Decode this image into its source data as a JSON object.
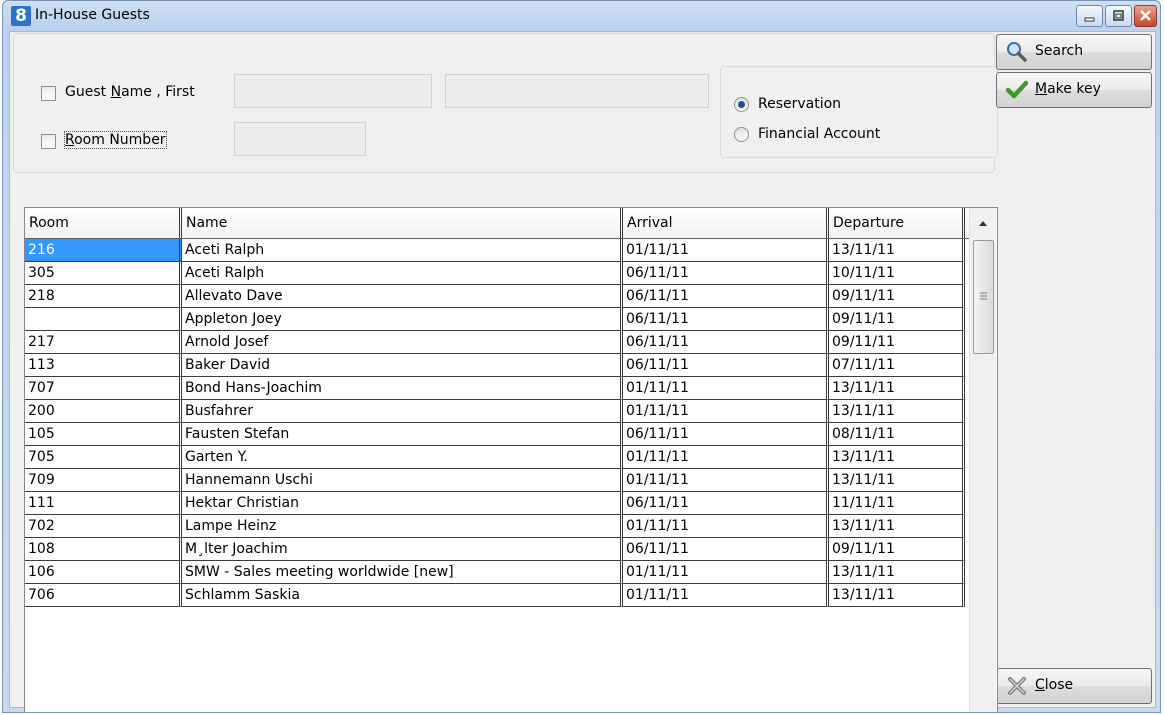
{
  "window": {
    "title": "In-House Guests",
    "app_icon_glyph": "8"
  },
  "filters": {
    "guest_name_label_pre": "Guest ",
    "guest_name_label_key": "N",
    "guest_name_label_post": "ame , First",
    "guest_name_checked": false,
    "guest_name_value": "",
    "guest_first_value": "",
    "room_number_label_key": "R",
    "room_number_label_post": "oom Number",
    "room_number_checked": false,
    "room_number_value": ""
  },
  "mode": {
    "reservation_label": "Reservation",
    "financial_label": "Financial Account",
    "selected": "Reservation"
  },
  "buttons": {
    "search": "Search",
    "make_key_key": "M",
    "make_key_rest": "ake key",
    "close_key": "C",
    "close_rest": "lose"
  },
  "table": {
    "columns": [
      "Room",
      "Name",
      "Arrival",
      "Departure"
    ],
    "rows": [
      {
        "room": "216",
        "name": "Aceti  Ralph",
        "arrival": "01/11/11",
        "departure": "13/11/11"
      },
      {
        "room": "305",
        "name": "Aceti  Ralph",
        "arrival": "06/11/11",
        "departure": "10/11/11"
      },
      {
        "room": "218",
        "name": "Allevato  Dave",
        "arrival": "06/11/11",
        "departure": "09/11/11"
      },
      {
        "room": "",
        "name": "Appleton  Joey",
        "arrival": "06/11/11",
        "departure": "09/11/11"
      },
      {
        "room": "217",
        "name": "Arnold  Josef",
        "arrival": "06/11/11",
        "departure": "09/11/11"
      },
      {
        "room": "113",
        "name": "Baker  David",
        "arrival": "06/11/11",
        "departure": "07/11/11"
      },
      {
        "room": "707",
        "name": "Bond  Hans-Joachim",
        "arrival": "01/11/11",
        "departure": "13/11/11"
      },
      {
        "room": "200",
        "name": "Busfahrer",
        "arrival": "01/11/11",
        "departure": "13/11/11"
      },
      {
        "room": "105",
        "name": "Fausten  Stefan",
        "arrival": "06/11/11",
        "departure": "08/11/11"
      },
      {
        "room": "705",
        "name": "Garten  Y.",
        "arrival": "01/11/11",
        "departure": "13/11/11"
      },
      {
        "room": "709",
        "name": "Hannemann  Uschi",
        "arrival": "01/11/11",
        "departure": "13/11/11"
      },
      {
        "room": "111",
        "name": "Hektar  Christian",
        "arrival": "06/11/11",
        "departure": "11/11/11"
      },
      {
        "room": "702",
        "name": "Lampe  Heinz",
        "arrival": "01/11/11",
        "departure": "13/11/11"
      },
      {
        "room": "108",
        "name": "M¸lter  Joachim",
        "arrival": "06/11/11",
        "departure": "09/11/11"
      },
      {
        "room": "106",
        "name": "SMW - Sales meeting worldwide [new]",
        "arrival": "01/11/11",
        "departure": "13/11/11"
      },
      {
        "room": "706",
        "name": "Schlamm  Saskia",
        "arrival": "01/11/11",
        "departure": "13/11/11"
      }
    ],
    "selected_row": 0
  },
  "icons": {
    "app": "app-logo-icon",
    "search": "magnifier-icon",
    "make_key": "checkmark-icon",
    "close": "close-x-icon"
  },
  "colors": {
    "selection": "#3399ff",
    "titlebar": "#b9d1ee",
    "close_button": "#c6452a"
  }
}
